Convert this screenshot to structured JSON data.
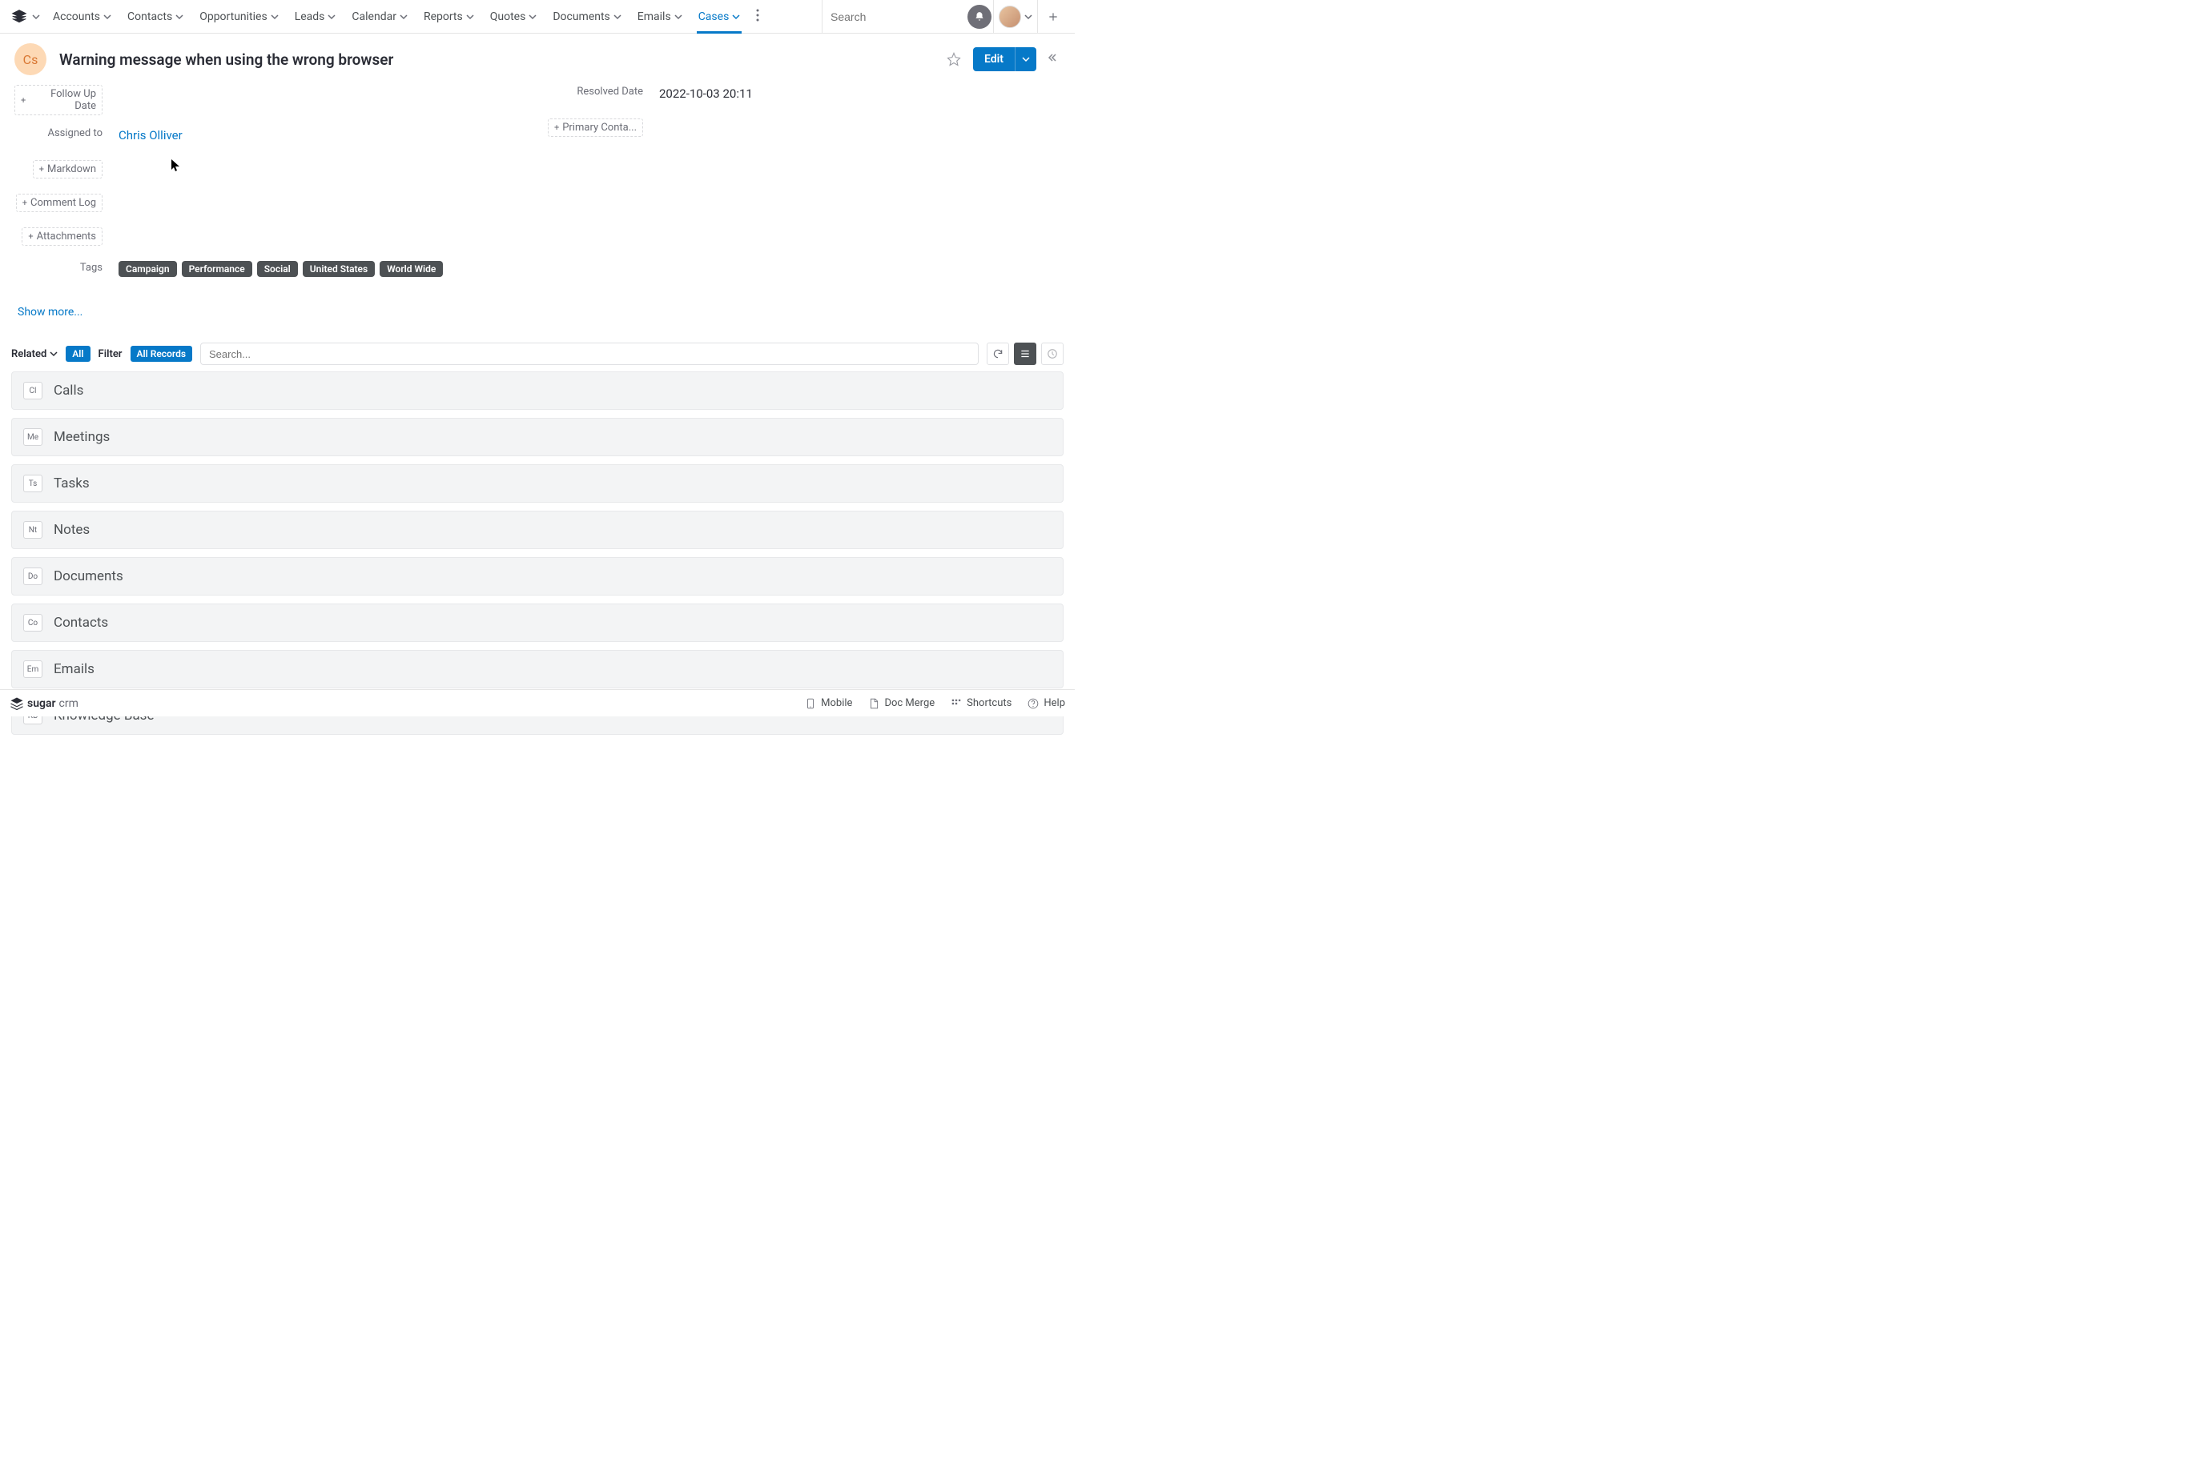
{
  "nav": {
    "items": [
      {
        "label": "Accounts"
      },
      {
        "label": "Contacts"
      },
      {
        "label": "Opportunities"
      },
      {
        "label": "Leads"
      },
      {
        "label": "Calendar"
      },
      {
        "label": "Reports"
      },
      {
        "label": "Quotes"
      },
      {
        "label": "Documents"
      },
      {
        "label": "Emails"
      },
      {
        "label": "Cases"
      }
    ],
    "search_placeholder": "Search"
  },
  "record": {
    "badge": "Cs",
    "title": "Warning message when using the wrong browser",
    "edit_label": "Edit"
  },
  "fields": {
    "follow_up_date": "Follow Up Date",
    "assigned_to_label": "Assigned to",
    "assigned_to_value": "Chris Olliver",
    "markdown": "Markdown",
    "comment_log": "Comment Log",
    "attachments": "Attachments",
    "tags_label": "Tags",
    "resolved_date_label": "Resolved Date",
    "resolved_date_value": "2022-10-03 20:11",
    "primary_contact": "Primary Conta...",
    "show_more": "Show more..."
  },
  "tags": [
    "Campaign",
    "Performance",
    "Social",
    "United States",
    "World Wide"
  ],
  "related": {
    "dropdown_label": "Related",
    "all_pill": "All",
    "filter_label": "Filter",
    "all_records_pill": "All Records",
    "search_placeholder": "Search..."
  },
  "panels": [
    {
      "badge": "Cl",
      "title": "Calls"
    },
    {
      "badge": "Me",
      "title": "Meetings"
    },
    {
      "badge": "Ts",
      "title": "Tasks"
    },
    {
      "badge": "Nt",
      "title": "Notes"
    },
    {
      "badge": "Do",
      "title": "Documents"
    },
    {
      "badge": "Co",
      "title": "Contacts"
    },
    {
      "badge": "Em",
      "title": "Emails"
    },
    {
      "badge": "KB",
      "title": "Knowledge Base"
    }
  ],
  "footer": {
    "brand_main": "sugar",
    "brand_sub": "crm",
    "mobile": "Mobile",
    "doc_merge": "Doc Merge",
    "shortcuts": "Shortcuts",
    "help": "Help"
  }
}
